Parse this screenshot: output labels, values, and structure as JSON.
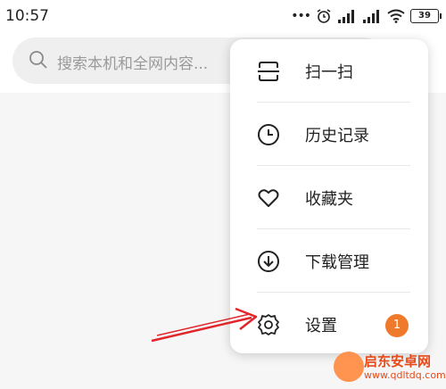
{
  "status_bar": {
    "time": "10:57",
    "dots": "•••",
    "battery": "39",
    "icons": [
      "alarm-icon",
      "signal-icon",
      "signal-icon",
      "wifi-icon",
      "battery-icon"
    ]
  },
  "search": {
    "placeholder": "搜索本机和全网内容..."
  },
  "menu": {
    "items": [
      {
        "label": "扫一扫",
        "icon": "scan-icon"
      },
      {
        "label": "历史记录",
        "icon": "clock-icon"
      },
      {
        "label": "收藏夹",
        "icon": "heart-icon"
      },
      {
        "label": "下载管理",
        "icon": "download-icon"
      },
      {
        "label": "设置",
        "icon": "gear-icon",
        "badge": "1"
      }
    ]
  },
  "colors": {
    "badge": "#f07a2c",
    "arrow": "#e0262a",
    "search_bg": "#efefef",
    "content_bg": "#f6f6f6"
  },
  "watermark": {
    "title": "启东安卓网",
    "url": "www.qdltdq.com"
  }
}
